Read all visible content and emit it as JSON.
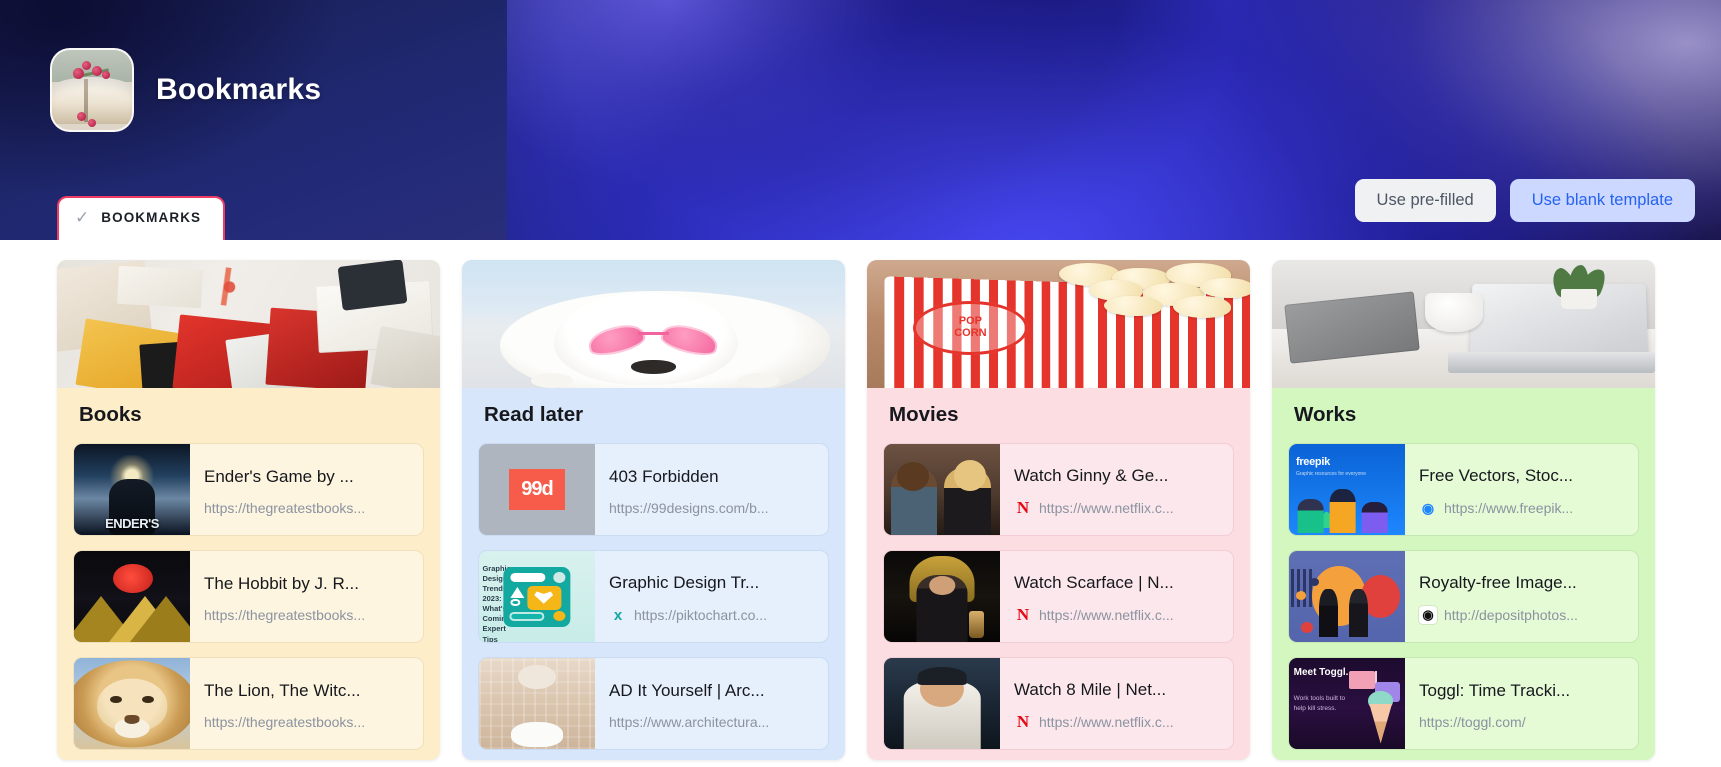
{
  "header": {
    "board_title": "Bookmarks",
    "avatar_name": "book-flowers-avatar",
    "tab": {
      "label": "BOOKMARKS",
      "check": "✓"
    },
    "actions": {
      "prefilled_label": "Use pre-filled",
      "blank_label": "Use blank template"
    },
    "colors": {
      "tab_border": "#ef3d61",
      "blank_btn_bg": "#ccd8ff",
      "blank_btn_text": "#2563f0",
      "prefilled_btn_bg": "#f0f1f3",
      "prefilled_btn_text": "#4d5665"
    }
  },
  "board": {
    "columns": [
      {
        "title": "Books",
        "bg": "#fdeec9",
        "cover": "books-on-desk",
        "cards": [
          {
            "title": "Ender's Game by ...",
            "url": "https://thegreatestbooks...",
            "thumb": "enders-game-cover",
            "favicon": ""
          },
          {
            "title": "The Hobbit by J. R...",
            "url": "https://thegreatestbooks...",
            "thumb": "the-hobbit-cover",
            "favicon": ""
          },
          {
            "title": "The Lion, The Witc...",
            "url": "https://thegreatestbooks...",
            "thumb": "the-lion-the-witch-cover",
            "favicon": ""
          }
        ]
      },
      {
        "title": "Read later",
        "bg": "#d7e6fb",
        "cover": "dog-with-heart-sunglasses",
        "cards": [
          {
            "title": "403 Forbidden",
            "url": "https://99designs.com/b...",
            "thumb": "99designs-logo",
            "favicon": ""
          },
          {
            "title": "Graphic Design Tr...",
            "url": "https://piktochart.co...",
            "thumb": "piktochart-graphic",
            "favicon": "piktochart-icon"
          },
          {
            "title": "AD It Yourself | Arc...",
            "url": "https://www.architectura...",
            "thumb": "bathroom-interior",
            "favicon": ""
          }
        ]
      },
      {
        "title": "Movies",
        "bg": "#fbdde2",
        "cover": "popcorn-boxes",
        "cards": [
          {
            "title": "Watch Ginny & Ge...",
            "url": "https://www.netflix.c...",
            "thumb": "ginny-and-georgia-still",
            "favicon": "netflix-icon"
          },
          {
            "title": "Watch Scarface | N...",
            "url": "https://www.netflix.c...",
            "thumb": "scarface-still",
            "favicon": "netflix-icon"
          },
          {
            "title": "Watch 8 Mile | Net...",
            "url": "https://www.netflix.c...",
            "thumb": "8-mile-still",
            "favicon": "netflix-icon"
          }
        ]
      },
      {
        "title": "Works",
        "bg": "#d4f7c0",
        "cover": "desk-with-laptop",
        "cards": [
          {
            "title": "Free Vectors, Stoc...",
            "url": "https://www.freepik...",
            "thumb": "freepik-illustration",
            "favicon": "freepik-icon"
          },
          {
            "title": "Royalty-free Image...",
            "url": "http://depositphotos...",
            "thumb": "depositphotos-illustration",
            "favicon": "depositphotos-icon"
          },
          {
            "title": "Toggl: Time Tracki...",
            "url": "https://toggl.com/",
            "thumb": "toggl-illustration",
            "favicon": ""
          }
        ]
      }
    ]
  }
}
